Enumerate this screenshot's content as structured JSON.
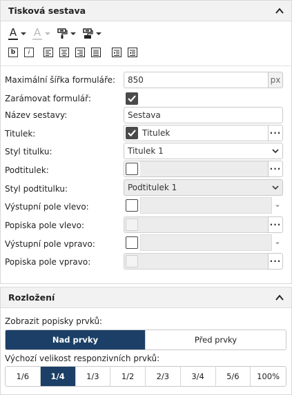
{
  "print_panel": {
    "title": "Tisková sestava",
    "fields": {
      "max_width": {
        "label": "Maximální šířka formuláře:",
        "value": "850",
        "unit": "px"
      },
      "frame": {
        "label": "Zarámovat formulář:",
        "checked": true
      },
      "name": {
        "label": "Název sestavy:",
        "value": "Sestava"
      },
      "title_field": {
        "label": "Titulek:",
        "checked": true,
        "value": "Titulek"
      },
      "title_style": {
        "label": "Styl titulku:",
        "value": "Titulek 1"
      },
      "subtitle": {
        "label": "Podtitulek:",
        "checked": false,
        "value": ""
      },
      "subtitle_style": {
        "label": "Styl podtitulku:",
        "value": "Podtitulek 1"
      },
      "left_output": {
        "label": "Výstupní pole vlevo:",
        "checked": false
      },
      "left_caption": {
        "label": "Popiska pole vlevo:"
      },
      "right_output": {
        "label": "Výstupní pole vpravo:",
        "checked": false
      },
      "right_caption": {
        "label": "Popiska pole vpravo:"
      }
    },
    "toolbar": {
      "text_color_letter": "A",
      "bg_color_letter": "A",
      "bold": "b",
      "italic": "i"
    },
    "dots": "···"
  },
  "layout_panel": {
    "title": "Rozložení",
    "show_captions_label": "Zobrazit popisky prvků:",
    "caption_options": [
      "Nad prvky",
      "Před prvky"
    ],
    "caption_selected": 0,
    "responsive_label": "Výchozí velikost responzivních prvků:",
    "size_options": [
      "1/6",
      "1/4",
      "1/3",
      "1/2",
      "2/3",
      "3/4",
      "5/6",
      "100%"
    ],
    "size_selected": 1
  },
  "colors": {
    "accent": "#1b3f66",
    "header_bg": "#f2f2f2",
    "border": "#c8c8c8"
  }
}
